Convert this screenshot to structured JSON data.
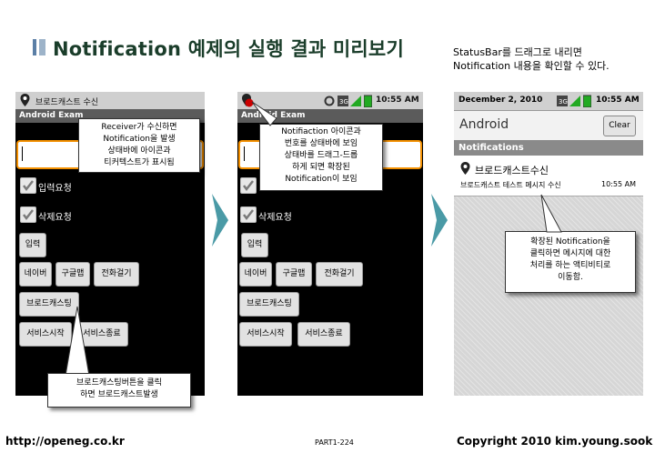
{
  "slide": {
    "title": "Notification 예제의 실행 결과 미리보기",
    "top_note_line1": "StatusBar를 드래그로 내리면",
    "top_note_line2": "Notification 내용을 확인할 수 있다.",
    "footer_left": "http://openeg.co.kr",
    "footer_mid": "PART1-224",
    "footer_right": "Copyright  2010 kim.young.sook"
  },
  "phone1": {
    "status_text": "브로드캐스트 수신",
    "app_title": "Android Exam",
    "checkbox1": "입력요청",
    "checkbox2": "삭제요청",
    "btn_input": "입력",
    "btn_naver": "네이버",
    "btn_google": "구글맵",
    "btn_call": "전화걸기",
    "btn_broadcast": "브로드캐스팅",
    "btn_service_start": "서비스시작",
    "btn_service_stop": "서비스종료",
    "callout_top": [
      "Receiver가 수신하면",
      "Notification을 발생",
      "상태바에 아이콘과",
      "티커텍스트가 표시됨"
    ],
    "callout_bottom": [
      "브로드캐스팅버튼을 클릭",
      "하면 브로드캐스트발생"
    ]
  },
  "phone2": {
    "time": "10:55 AM",
    "app_title": "Android Exam",
    "checkbox2": "삭제요청",
    "btn_input": "입력",
    "btn_naver": "네이버",
    "btn_google": "구글맵",
    "btn_call": "전화걸기",
    "btn_broadcast": "브로드캐스팅",
    "btn_service_start": "서비스시작",
    "btn_service_stop": "서비스종료",
    "callout": [
      "Notifiaction 아이콘과",
      "번호를 상태바에 보임",
      "상태바를 드래그-드롭",
      "하게 되면 확장된",
      "Notification이 보임"
    ]
  },
  "phone3": {
    "date": "December 2, 2010",
    "time": "10:55 AM",
    "app_name": "Android",
    "clear_label": "Clear",
    "section_title": "Notifications",
    "notif_title": "브로드캐스트수신",
    "notif_text": "브로드캐스트 테스트 메시지 수신",
    "notif_time": "10:55 AM",
    "callout": [
      "확장된 Notification을",
      "클릭하면 메시지에 대한",
      "처리를 하는 액티비티로",
      "이동함."
    ]
  },
  "colors": {
    "title_green": "#1a3d2a",
    "edit_focus": "#f49000",
    "arrow_teal": "#4a9aa6"
  }
}
